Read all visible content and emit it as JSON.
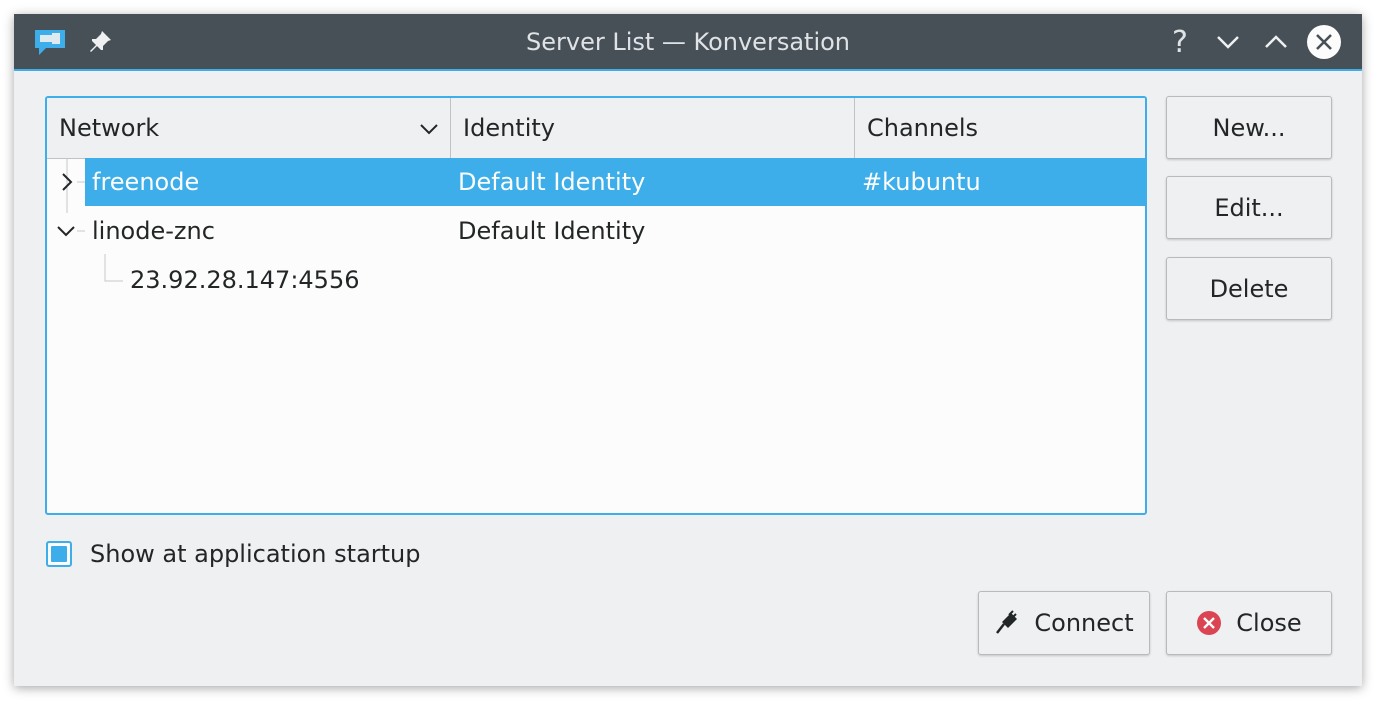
{
  "window": {
    "title": "Server List — Konversation"
  },
  "titlebar": {
    "help_label": "?"
  },
  "tree": {
    "headers": {
      "network": "Network",
      "identity": "Identity",
      "channels": "Channels"
    },
    "rows": [
      {
        "network": "freenode",
        "identity": "Default Identity",
        "channels": "#kubuntu",
        "selected": true,
        "expanded": false
      },
      {
        "network": "linode-znc",
        "identity": "Default Identity",
        "channels": "",
        "selected": false,
        "expanded": true
      },
      {
        "network": "23.92.28.147:4556",
        "identity": "",
        "channels": "",
        "child": true
      }
    ]
  },
  "buttons": {
    "new": "New...",
    "edit": "Edit...",
    "delete": "Delete",
    "connect": "Connect",
    "close": "Close"
  },
  "startup_checkbox": {
    "label": "Show at application startup",
    "checked": true
  },
  "colors": {
    "accent": "#3daee9",
    "titlebar": "#475057",
    "window_bg": "#eff0f1",
    "close_icon": "#da4453"
  }
}
